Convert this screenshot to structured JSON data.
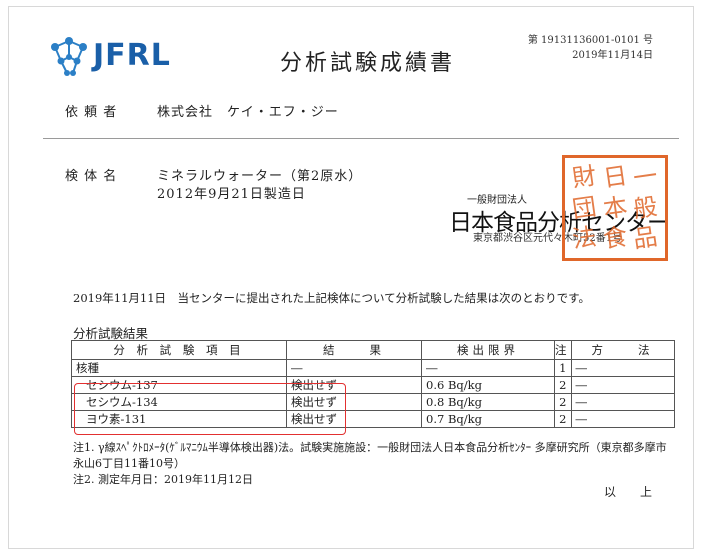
{
  "header": {
    "logo_text": "JFRL",
    "title": "分析試験成績書",
    "doc_number": "第 19131136001-0101 号",
    "doc_date": "2019年11月14日"
  },
  "client": {
    "label": "依 頼 者",
    "value": "株式会社　ケイ・エフ・ジー"
  },
  "sample": {
    "label": "検 体 名",
    "name": "ミネラルウォーター（第2原水）",
    "manufactured": "2012年9月21日製造日"
  },
  "organization": {
    "type": "一般財団法人",
    "name": "日本食品分析センター",
    "address": "東京都渋谷区元代々木町52番1号",
    "seal_chars": [
      "財",
      "日",
      "一",
      "団",
      "本",
      "般",
      "法",
      "食",
      "品"
    ]
  },
  "statement": "2019年11月11日　当センターに提出された上記検体について分析試験した結果は次のとおりです。",
  "results": {
    "section_title": "分析試験結果",
    "headers": [
      "分 析 試 験 項 目",
      "結　　果",
      "検出限界",
      "注",
      "方　　法"
    ],
    "rows": [
      {
        "item": "核種",
        "result": "―",
        "limit": "―",
        "note": "1",
        "method": "―"
      },
      {
        "item": "セシウム-137",
        "result": "検出せず",
        "limit": "0.6 Bq/kg",
        "note": "2",
        "method": "―"
      },
      {
        "item": "セシウム-134",
        "result": "検出せず",
        "limit": "0.8 Bq/kg",
        "note": "2",
        "method": "―"
      },
      {
        "item": "ヨウ素-131",
        "result": "検出せず",
        "limit": "0.7 Bq/kg",
        "note": "2",
        "method": "―"
      }
    ]
  },
  "notes": {
    "note1_line1": "注1. γ線ｽﾍﾟｸﾄﾛﾒｰﾀ(ｹﾞﾙﾏﾆｳﾑ半導体検出器)法。試験実施施設：一般財団法人日本食品分析ｾﾝﾀｰ 多摩研究所（東京都多摩市",
    "note1_line2": "永山6丁目11番10号）",
    "note2": "注2.  測定年月日：2019年11月12日",
    "closing": "以　上"
  }
}
